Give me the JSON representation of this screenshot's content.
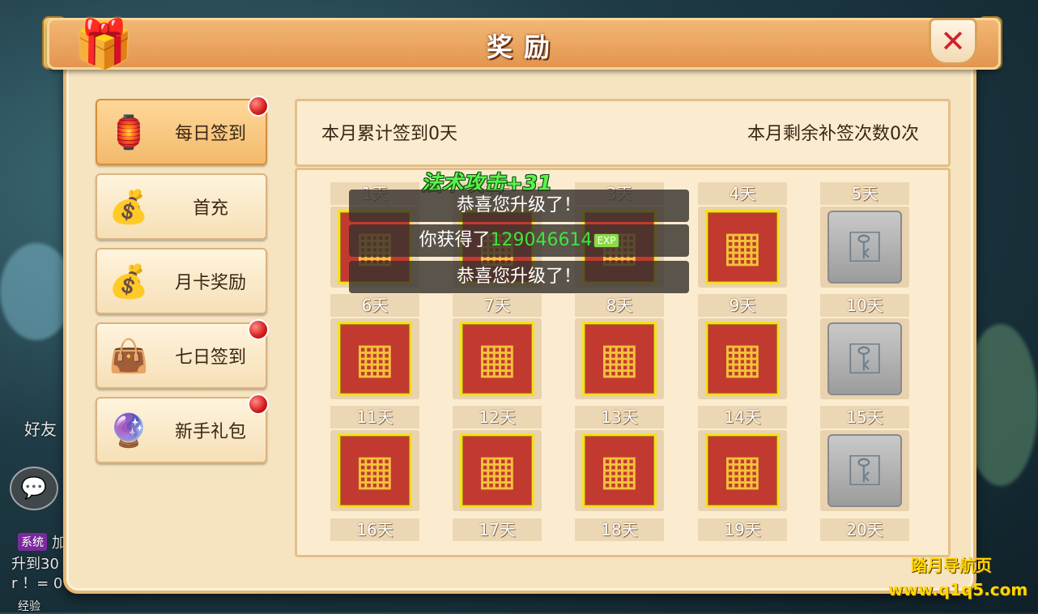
{
  "window": {
    "title": "奖励"
  },
  "background": {
    "left_texts": [
      "好友",
      "加",
      "升到30",
      "r ！= 0",
      "经验"
    ],
    "system_tag": "系统",
    "exp_tag": "EXP"
  },
  "sidebar": {
    "items": [
      {
        "label": "每日签到",
        "icon": "lantern-icon",
        "active": true,
        "has_red_dot": true
      },
      {
        "label": "首充",
        "icon": "money-bag-icon",
        "active": false,
        "has_red_dot": false
      },
      {
        "label": "月卡奖励",
        "icon": "money-bag-icon",
        "active": false,
        "has_red_dot": false
      },
      {
        "label": "七日签到",
        "icon": "blue-bag-icon",
        "active": false,
        "has_red_dot": true
      },
      {
        "label": "新手礼包",
        "icon": "magic-stone-icon",
        "active": false,
        "has_red_dot": true
      }
    ]
  },
  "info": {
    "monthly_signin": "本月累计签到0天",
    "remaining_makeup": "本月剩余补签次数0次"
  },
  "days": [
    {
      "label": "1天",
      "reward": "gift"
    },
    {
      "label": "2天",
      "reward": "gift"
    },
    {
      "label": "3天",
      "reward": "gift"
    },
    {
      "label": "4天",
      "reward": "gift"
    },
    {
      "label": "5天",
      "reward": "key"
    },
    {
      "label": "6天",
      "reward": "gift"
    },
    {
      "label": "7天",
      "reward": "gift"
    },
    {
      "label": "8天",
      "reward": "gift"
    },
    {
      "label": "9天",
      "reward": "gift"
    },
    {
      "label": "10天",
      "reward": "key"
    },
    {
      "label": "11天",
      "reward": "gift"
    },
    {
      "label": "12天",
      "reward": "gift"
    },
    {
      "label": "13天",
      "reward": "gift"
    },
    {
      "label": "14天",
      "reward": "gift"
    },
    {
      "label": "15天",
      "reward": "key"
    },
    {
      "label": "16天",
      "reward": "none"
    },
    {
      "label": "17天",
      "reward": "none"
    },
    {
      "label": "18天",
      "reward": "none"
    },
    {
      "label": "19天",
      "reward": "none"
    },
    {
      "label": "20天",
      "reward": "none"
    }
  ],
  "toasts": {
    "levelup_1": "恭喜您升级了！",
    "gain_prefix": "你获得了",
    "gain_amount": "129046614",
    "gain_suffix": "EXP",
    "levelup_2": "恭喜您升级了！"
  },
  "floating_text": "法术攻击+31",
  "watermark": {
    "line1": "踏月导航页",
    "line2": "www.q1q5.com"
  },
  "colors": {
    "gift_border": "#f6e01a",
    "red_dot": "#d61a1a",
    "exp_green": "#3fe43a",
    "title_orange": "#e29550"
  }
}
